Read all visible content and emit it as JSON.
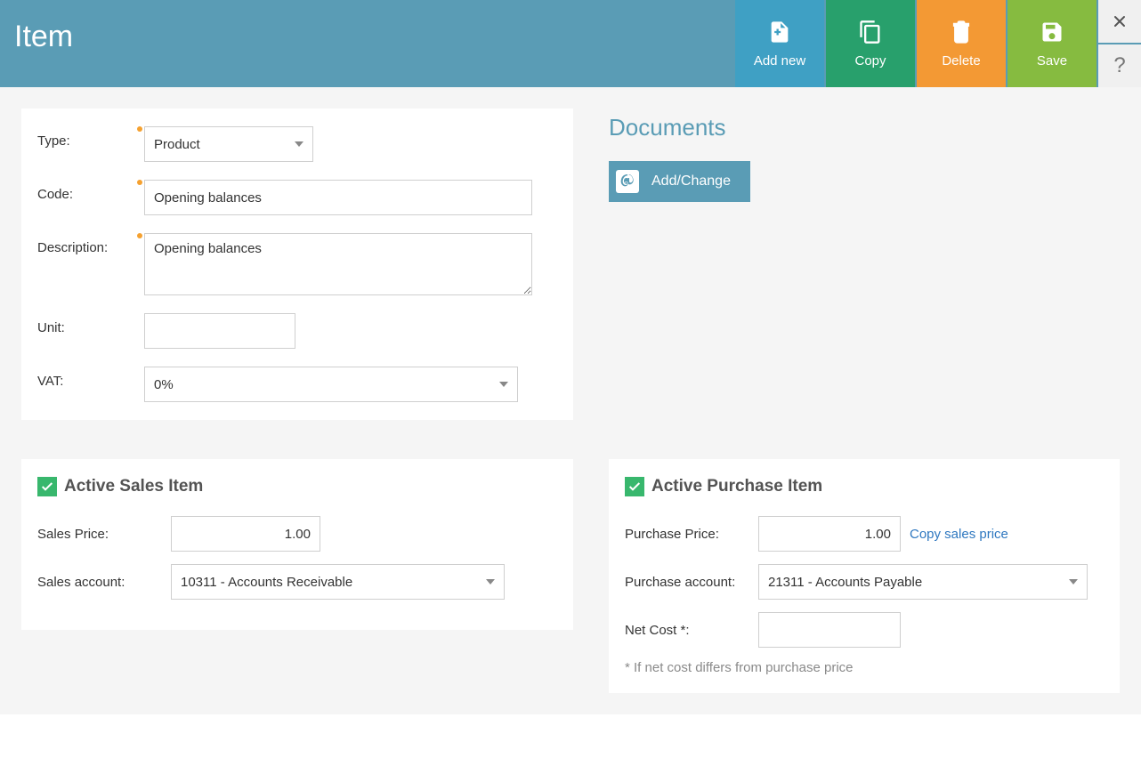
{
  "header": {
    "title": "Item",
    "actions": {
      "add_new": "Add new",
      "copy": "Copy",
      "delete": "Delete",
      "save": "Save"
    }
  },
  "item": {
    "type_label": "Type:",
    "type_value": "Product",
    "code_label": "Code:",
    "code_value": "Opening balances",
    "description_label": "Description:",
    "description_value": "Opening balances",
    "unit_label": "Unit:",
    "unit_value": "",
    "vat_label": "VAT:",
    "vat_value": "0%"
  },
  "documents": {
    "title": "Documents",
    "add_change": "Add/Change"
  },
  "sales": {
    "heading": "Active Sales Item",
    "price_label": "Sales Price:",
    "price_value": "1.00",
    "account_label": "Sales account:",
    "account_value": "10311 - Accounts Receivable"
  },
  "purchase": {
    "heading": "Active Purchase Item",
    "price_label": "Purchase Price:",
    "price_value": "1.00",
    "copy_link": "Copy sales price",
    "account_label": "Purchase account:",
    "account_value": "21311 - Accounts Payable",
    "netcost_label": "Net Cost *:",
    "netcost_value": "",
    "netcost_hint": "* If net cost differs from purchase price"
  }
}
